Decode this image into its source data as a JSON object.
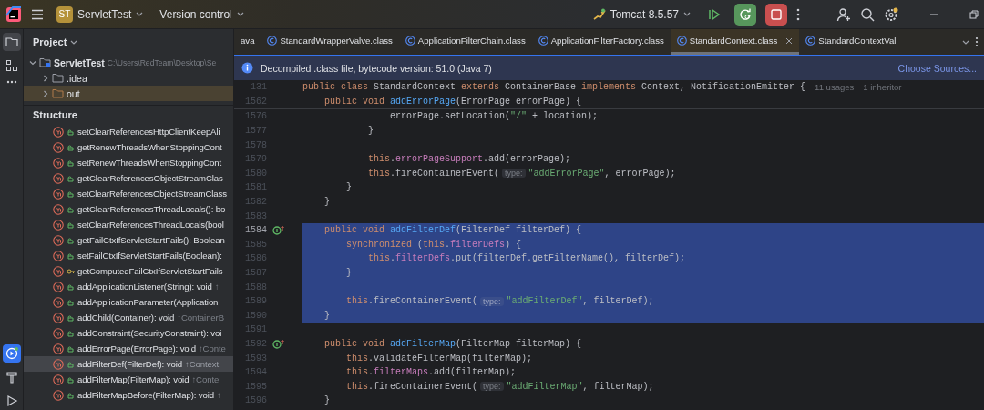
{
  "title_bar": {
    "project": {
      "badge": "ST",
      "name": "ServletTest"
    },
    "vcs": "Version control",
    "run_config": "Tomcat 8.5.57"
  },
  "tool_strip": {
    "top": [
      {
        "kind": "project",
        "selected": true
      },
      {
        "kind": "structure",
        "selected": false
      }
    ],
    "bottom": [
      {
        "kind": "services",
        "selected": true
      },
      {
        "kind": "build",
        "selected": false
      },
      {
        "kind": "run",
        "selected": false
      }
    ]
  },
  "project_panel": {
    "title": "Project",
    "tree": [
      {
        "name": "ServletTest",
        "path": "C:\\Users\\RedTeam\\Desktop\\Se",
        "expanded": true,
        "excluded": false,
        "children": [
          {
            "name": ".idea",
            "expanded": false,
            "excluded": false
          },
          {
            "name": "out",
            "expanded": false,
            "excluded": true
          }
        ]
      }
    ]
  },
  "structure_panel": {
    "title": "Structure",
    "items": [
      {
        "name": "setClearReferencesHttpClientKeepAli",
        "restricted": false,
        "selected": false
      },
      {
        "name": "getRenewThreadsWhenStoppingCont",
        "restricted": false,
        "selected": false
      },
      {
        "name": "setRenewThreadsWhenStoppingCont",
        "restricted": false,
        "selected": false
      },
      {
        "name": "getClearReferencesObjectStreamClas",
        "restricted": false,
        "selected": false
      },
      {
        "name": "setClearReferencesObjectStreamClass",
        "restricted": false,
        "selected": false
      },
      {
        "name": "getClearReferencesThreadLocals(): bo",
        "restricted": false,
        "selected": false
      },
      {
        "name": "setClearReferencesThreadLocals(bool",
        "restricted": false,
        "selected": false
      },
      {
        "name": "getFailCtxIfServletStartFails(): Boolean",
        "restricted": false,
        "selected": false
      },
      {
        "name": "setFailCtxIfServletStartFails(Boolean):",
        "restricted": false,
        "selected": false
      },
      {
        "name": "getComputedFailCtxIfServletStartFails",
        "restricted": true,
        "selected": false
      },
      {
        "name": "addApplicationListener(String): void",
        "inherited": "↑",
        "restricted": false,
        "selected": false
      },
      {
        "name": "addApplicationParameter(Application",
        "restricted": false,
        "selected": false
      },
      {
        "name": "addChild(Container): void",
        "inherited": "↑ContainerB",
        "restricted": false,
        "selected": false
      },
      {
        "name": "addConstraint(SecurityConstraint): voi",
        "restricted": false,
        "selected": false
      },
      {
        "name": "addErrorPage(ErrorPage): void",
        "inherited": "↑Conte",
        "restricted": false,
        "selected": false
      },
      {
        "name": "addFilterDef(FilterDef): void",
        "inherited": "↑Context",
        "restricted": false,
        "selected": true
      },
      {
        "name": "addFilterMap(FilterMap): void",
        "inherited": "↑Conte",
        "restricted": false,
        "selected": false
      },
      {
        "name": "addFilterMapBefore(FilterMap): void",
        "inherited": "↑",
        "restricted": false,
        "selected": false
      }
    ]
  },
  "editor": {
    "tabs": [
      {
        "label": "ava",
        "icon": false,
        "selected": false,
        "closable": false
      },
      {
        "label": "StandardWrapperValve.class",
        "icon": true,
        "selected": false,
        "closable": false
      },
      {
        "label": "ApplicationFilterChain.class",
        "icon": true,
        "selected": false,
        "closable": false
      },
      {
        "label": "ApplicationFilterFactory.class",
        "icon": true,
        "selected": false,
        "closable": false
      },
      {
        "label": "StandardContext.class",
        "icon": true,
        "selected": true,
        "closable": true
      },
      {
        "label": "StandardContextVal",
        "icon": true,
        "selected": false,
        "closable": false
      }
    ],
    "banner": {
      "message": "Decompiled .class file, bytecode version: 51.0 (Java 7)",
      "action": "Choose Sources..."
    },
    "sticky_lines": [
      {
        "number": "131",
        "tokens": [
          {
            "kind": "keyword",
            "text": "public class "
          },
          {
            "kind": "plain",
            "text": "StandardContext "
          },
          {
            "kind": "keyword",
            "text": "extends "
          },
          {
            "kind": "plain",
            "text": "ContainerBase "
          },
          {
            "kind": "keyword",
            "text": "implements "
          },
          {
            "kind": "plain",
            "text": "Context, NotificationEmitter {"
          }
        ],
        "usages": "11 usages",
        "inheritors": "1 inheritor"
      },
      {
        "number": "1562",
        "tokens": [
          {
            "kind": "keyword",
            "text": "    public void "
          },
          {
            "kind": "declaration",
            "text": "addErrorPage"
          },
          {
            "kind": "plain",
            "text": "(ErrorPage errorPage) {"
          }
        ]
      }
    ],
    "lines": [
      {
        "number": "1576",
        "marker": false,
        "current": false,
        "selected": false,
        "tokens": [
          {
            "kind": "plain",
            "text": "                errorPage.setLocation("
          },
          {
            "kind": "string",
            "text": "\"/\""
          },
          {
            "kind": "plain",
            "text": " + location);"
          }
        ]
      },
      {
        "number": "1577",
        "marker": false,
        "current": false,
        "selected": false,
        "tokens": [
          {
            "kind": "plain",
            "text": "            }"
          }
        ]
      },
      {
        "number": "1578",
        "marker": false,
        "current": false,
        "selected": false
      },
      {
        "number": "1579",
        "marker": false,
        "current": false,
        "selected": false,
        "tokens": [
          {
            "kind": "keyword",
            "text": "            this"
          },
          {
            "kind": "plain",
            "text": "."
          },
          {
            "kind": "field",
            "text": "errorPageSupport"
          },
          {
            "kind": "plain",
            "text": ".add(errorPage);"
          }
        ]
      },
      {
        "number": "1580",
        "marker": false,
        "current": false,
        "selected": false,
        "tokens": [
          {
            "kind": "keyword",
            "text": "            this"
          },
          {
            "kind": "plain",
            "text": ".fireContainerEvent("
          },
          {
            "kind": "hint",
            "text": "type:"
          },
          {
            "kind": "string",
            "text": "\"addErrorPage\""
          },
          {
            "kind": "plain",
            "text": ", errorPage);"
          }
        ]
      },
      {
        "number": "1581",
        "marker": false,
        "current": false,
        "selected": false,
        "tokens": [
          {
            "kind": "plain",
            "text": "        }"
          }
        ]
      },
      {
        "number": "1582",
        "marker": false,
        "current": false,
        "selected": false,
        "tokens": [
          {
            "kind": "plain",
            "text": "    }"
          }
        ]
      },
      {
        "number": "1583",
        "marker": false,
        "current": false,
        "selected": false
      },
      {
        "number": "1584",
        "marker": true,
        "current": true,
        "selected": true,
        "tokens": [
          {
            "kind": "keyword",
            "text": "    public void "
          },
          {
            "kind": "declaration",
            "text": "addFilterDef"
          },
          {
            "kind": "plain",
            "text": "(FilterDef filterDef) {"
          }
        ]
      },
      {
        "number": "1585",
        "marker": false,
        "current": false,
        "selected": true,
        "tokens": [
          {
            "kind": "keyword",
            "text": "        synchronized "
          },
          {
            "kind": "plain",
            "text": "("
          },
          {
            "kind": "keyword",
            "text": "this"
          },
          {
            "kind": "plain",
            "text": "."
          },
          {
            "kind": "field",
            "text": "filterDefs"
          },
          {
            "kind": "plain",
            "text": ") {"
          }
        ]
      },
      {
        "number": "1586",
        "marker": false,
        "current": false,
        "selected": true,
        "tokens": [
          {
            "kind": "keyword",
            "text": "            this"
          },
          {
            "kind": "plain",
            "text": "."
          },
          {
            "kind": "field",
            "text": "filterDefs"
          },
          {
            "kind": "plain",
            "text": ".put(filterDef.getFilterName(), filterDef);"
          }
        ]
      },
      {
        "number": "1587",
        "marker": false,
        "current": false,
        "selected": true,
        "tokens": [
          {
            "kind": "plain",
            "text": "        }"
          }
        ]
      },
      {
        "number": "1588",
        "marker": false,
        "current": false,
        "selected": true
      },
      {
        "number": "1589",
        "marker": false,
        "current": false,
        "selected": true,
        "tokens": [
          {
            "kind": "keyword",
            "text": "        this"
          },
          {
            "kind": "plain",
            "text": ".fireContainerEvent("
          },
          {
            "kind": "hint",
            "text": "type:"
          },
          {
            "kind": "string",
            "text": "\"addFilterDef\""
          },
          {
            "kind": "plain",
            "text": ", filterDef);"
          }
        ]
      },
      {
        "number": "1590",
        "marker": false,
        "current": false,
        "selected": true,
        "tokens": [
          {
            "kind": "plain",
            "text": "    }"
          }
        ]
      },
      {
        "number": "1591",
        "marker": false,
        "current": false,
        "selected": false
      },
      {
        "number": "1592",
        "marker": true,
        "current": false,
        "selected": false,
        "tokens": [
          {
            "kind": "keyword",
            "text": "    public void "
          },
          {
            "kind": "declaration",
            "text": "addFilterMap"
          },
          {
            "kind": "plain",
            "text": "(FilterMap filterMap) {"
          }
        ]
      },
      {
        "number": "1593",
        "marker": false,
        "current": false,
        "selected": false,
        "tokens": [
          {
            "kind": "keyword",
            "text": "        this"
          },
          {
            "kind": "plain",
            "text": ".validateFilterMap(filterMap);"
          }
        ]
      },
      {
        "number": "1594",
        "marker": false,
        "current": false,
        "selected": false,
        "tokens": [
          {
            "kind": "keyword",
            "text": "        this"
          },
          {
            "kind": "plain",
            "text": "."
          },
          {
            "kind": "field",
            "text": "filterMaps"
          },
          {
            "kind": "plain",
            "text": ".add(filterMap);"
          }
        ]
      },
      {
        "number": "1595",
        "marker": false,
        "current": false,
        "selected": false,
        "tokens": [
          {
            "kind": "keyword",
            "text": "        this"
          },
          {
            "kind": "plain",
            "text": ".fireContainerEvent("
          },
          {
            "kind": "hint",
            "text": "type:"
          },
          {
            "kind": "string",
            "text": "\"addFilterMap\""
          },
          {
            "kind": "plain",
            "text": ", filterMap);"
          }
        ]
      },
      {
        "number": "1596",
        "marker": false,
        "current": false,
        "selected": false,
        "tokens": [
          {
            "kind": "plain",
            "text": "    }"
          }
        ]
      }
    ]
  }
}
